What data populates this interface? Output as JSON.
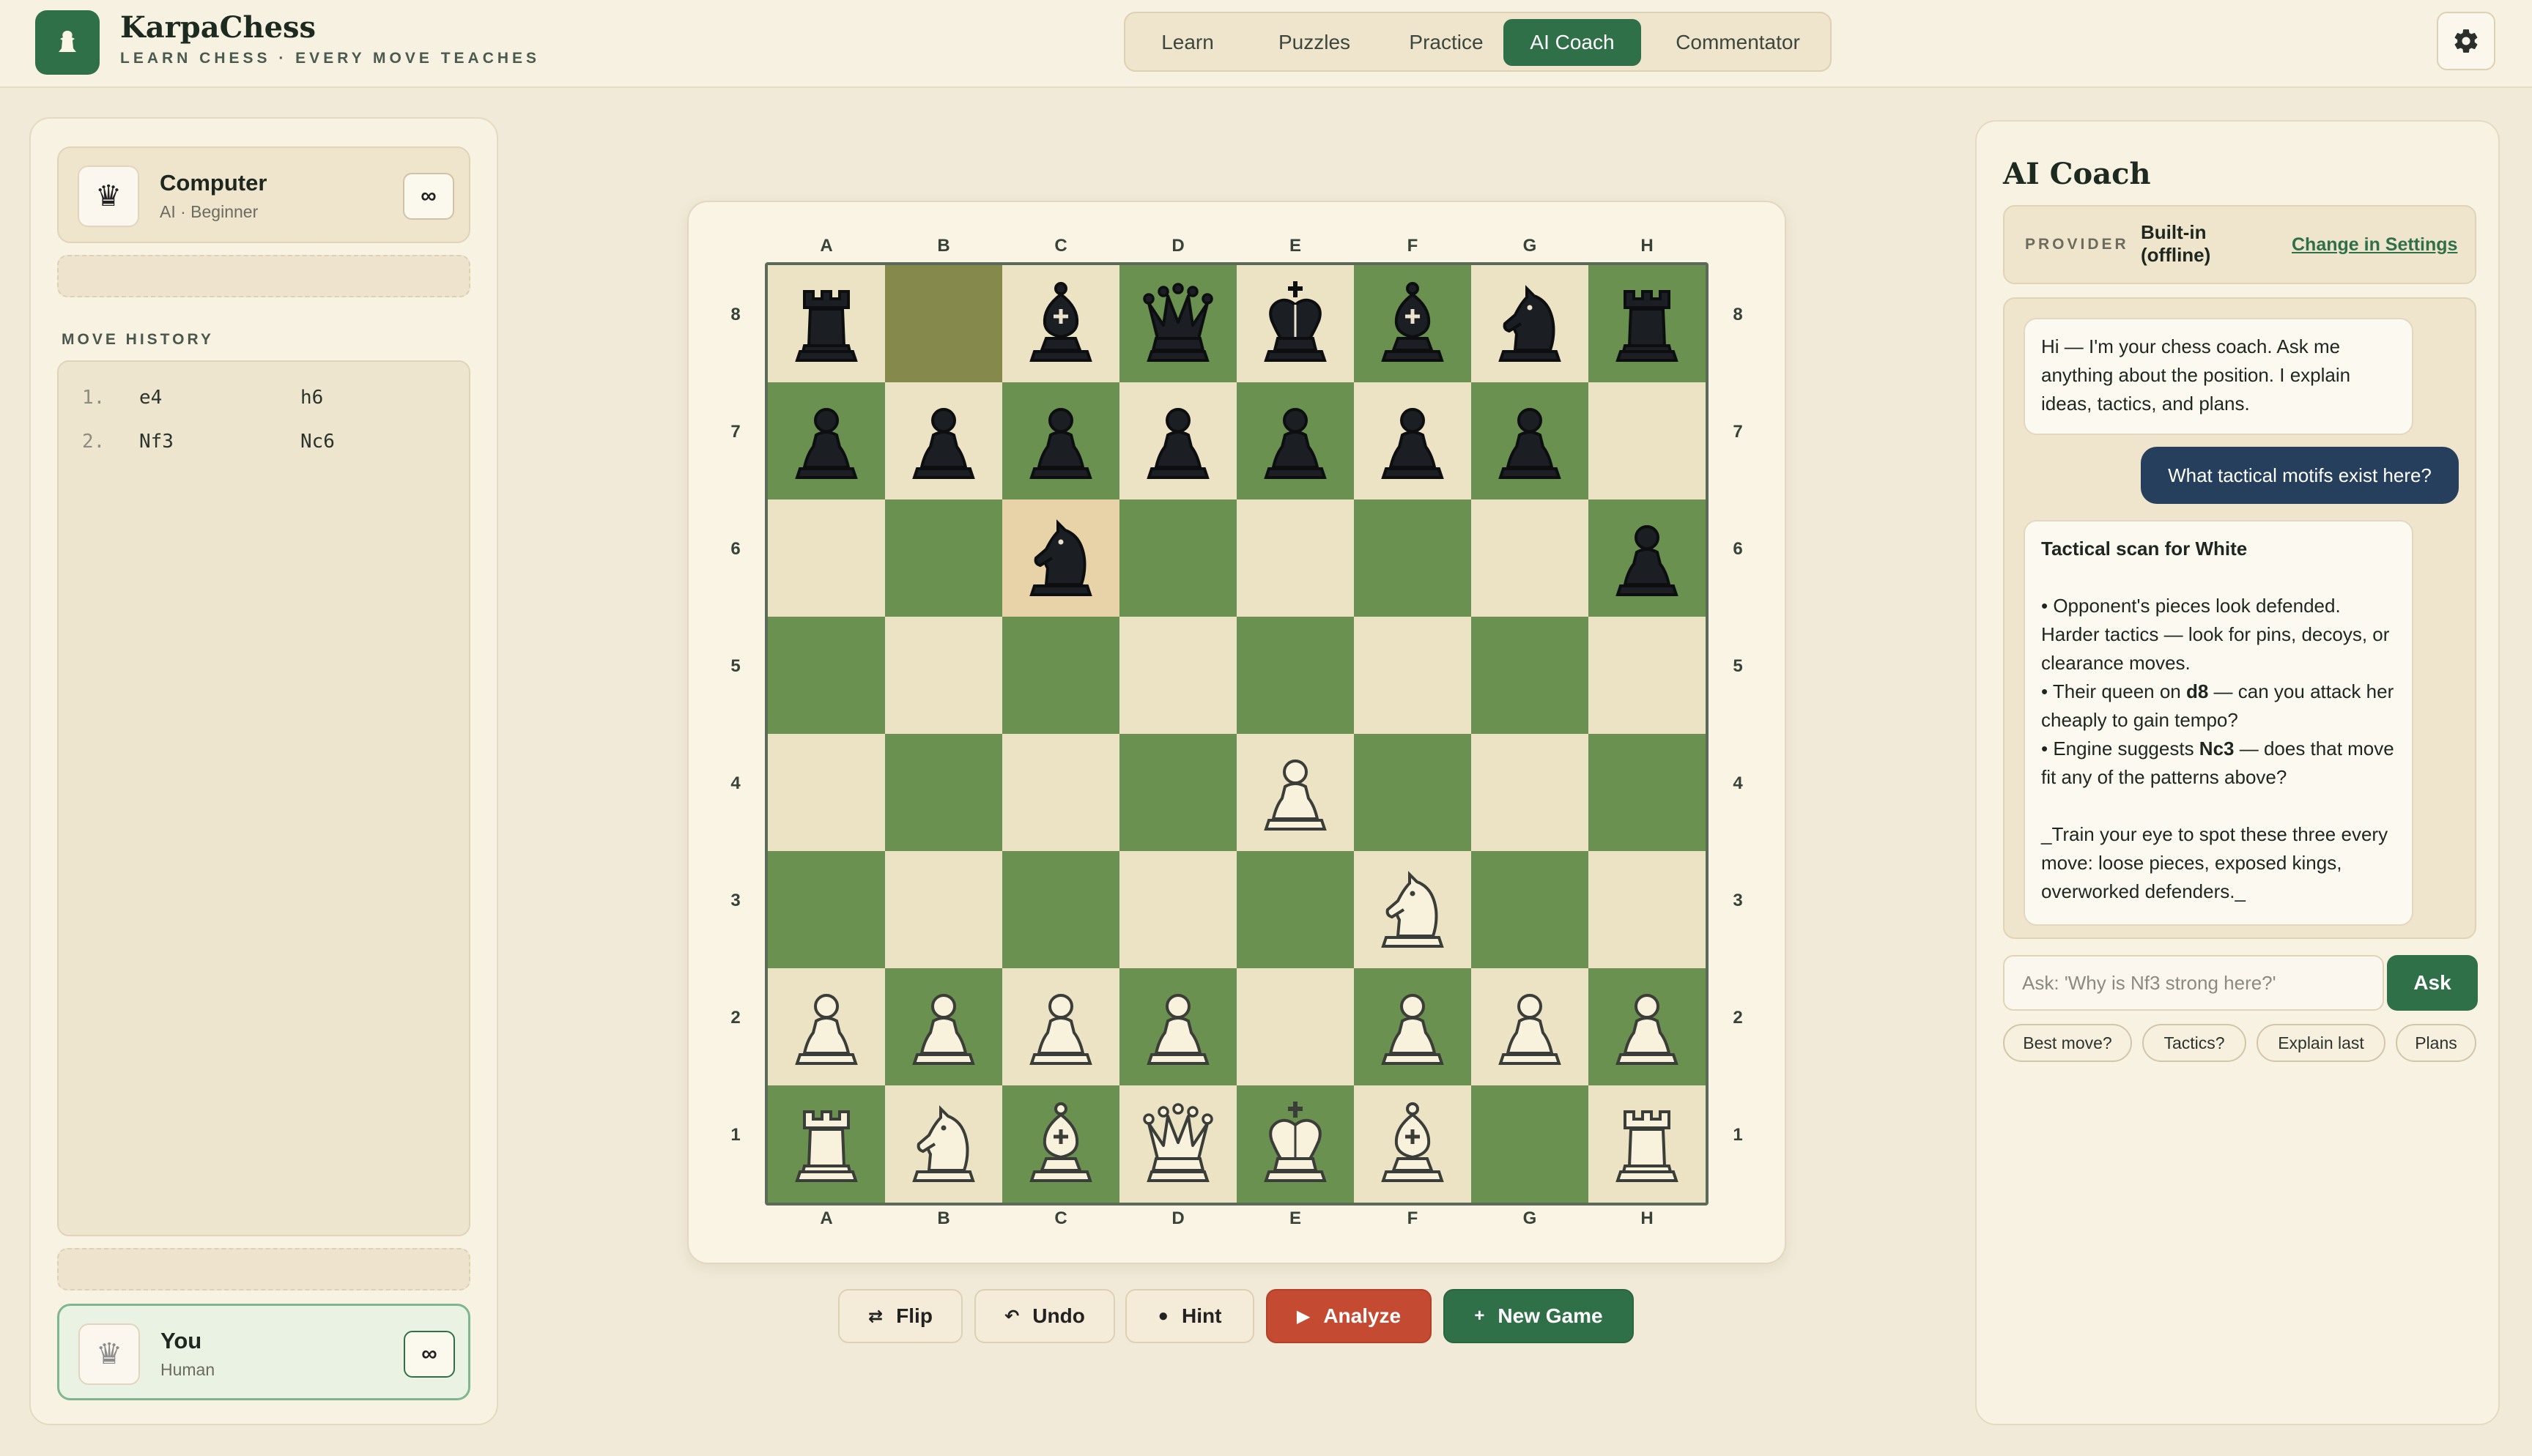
{
  "app": {
    "title": "KarpaChess",
    "subtitle": "LEARN CHESS · EVERY MOVE TEACHES"
  },
  "nav": {
    "tabs": [
      {
        "label": "Learn",
        "active": false
      },
      {
        "label": "Puzzles",
        "active": false
      },
      {
        "label": "Practice",
        "active": false
      },
      {
        "label": "AI Coach",
        "active": true
      },
      {
        "label": "Commentator",
        "active": false
      }
    ]
  },
  "icons": {
    "logo": "pawn-icon",
    "settings": "gear-icon"
  },
  "colors": {
    "brand": "#2f7049",
    "analyze": "#c44a32",
    "user_bubble": "#263f5c",
    "board_light": "#ece3c5",
    "board_dark": "#6a9150"
  },
  "players": {
    "top": {
      "name": "Computer",
      "sub": "AI · Beginner",
      "clock": "∞",
      "piece": "♛"
    },
    "bottom": {
      "name": "You",
      "sub": "Human",
      "clock": "∞",
      "piece": "♛"
    }
  },
  "move_history": {
    "label": "MOVE HISTORY",
    "moves": [
      {
        "num": "1.",
        "white": "e4",
        "black": "h6"
      },
      {
        "num": "2.",
        "white": "Nf3",
        "black": "Nc6"
      }
    ]
  },
  "board": {
    "files": [
      "A",
      "B",
      "C",
      "D",
      "E",
      "F",
      "G",
      "H"
    ],
    "ranks": [
      "8",
      "7",
      "6",
      "5",
      "4",
      "3",
      "2",
      "1"
    ],
    "position": [
      [
        "bR",
        "",
        "bB",
        "bQ",
        "bK",
        "bB",
        "bN",
        "bR"
      ],
      [
        "bP",
        "bP",
        "bP",
        "bP",
        "bP",
        "bP",
        "bP",
        ""
      ],
      [
        "",
        "",
        "bN",
        "",
        "",
        "",
        "",
        "bP"
      ],
      [
        "",
        "",
        "",
        "",
        "",
        "",
        "",
        ""
      ],
      [
        "",
        "",
        "",
        "",
        "wP",
        "",
        "",
        ""
      ],
      [
        "",
        "",
        "",
        "",
        "",
        "wN",
        "",
        ""
      ],
      [
        "wP",
        "wP",
        "wP",
        "wP",
        "",
        "wP",
        "wP",
        "wP"
      ],
      [
        "wR",
        "wN",
        "wB",
        "wQ",
        "wK",
        "wB",
        "",
        "wR"
      ]
    ],
    "last_move": {
      "from": "b8",
      "to": "c6"
    }
  },
  "controls": {
    "flip": "Flip",
    "undo": "Undo",
    "hint": "Hint",
    "analyze": "Analyze",
    "new_game": "New Game"
  },
  "coach": {
    "title": "AI Coach",
    "provider_label": "PROVIDER",
    "provider_value": "Built-in (offline)",
    "provider_link": "Change in Settings",
    "greeting": "Hi — I'm your chess coach. Ask me anything about the position. I explain ideas, tactics, and plans.",
    "user_message": "What tactical motifs exist here?",
    "reply_title": "Tactical scan for White",
    "reply_line1": "• Opponent's pieces look defended. Harder tactics — look for pins, decoys, or clearance moves.",
    "reply_line2_pre": "• Their queen on ",
    "reply_line2_bold": "d8",
    "reply_line2_post": " — can you attack her cheaply to gain tempo?",
    "reply_line3_pre": "• Engine suggests ",
    "reply_line3_bold": "Nc3",
    "reply_line3_post": " — does that move fit any of the patterns above?",
    "reply_footer": "_Train your eye to spot these three every move: loose pieces, exposed kings, overworked defenders._",
    "input_placeholder": "Ask: 'Why is Nf3 strong here?'",
    "ask_label": "Ask",
    "chips": [
      "Best move?",
      "Tactics?",
      "Explain last",
      "Plans"
    ]
  }
}
